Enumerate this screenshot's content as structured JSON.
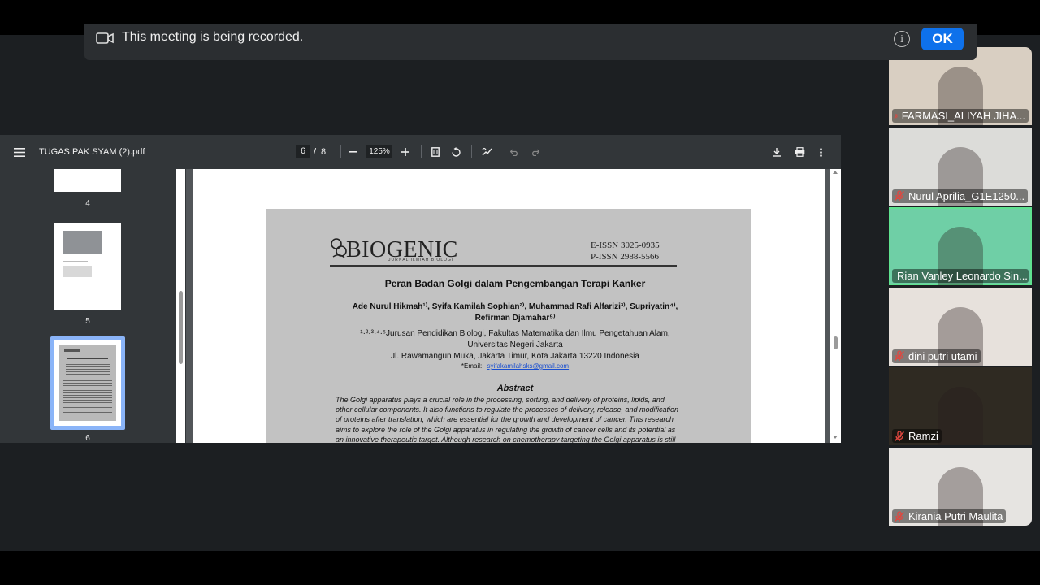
{
  "banner": {
    "message": "This meeting is being recorded.",
    "ok_label": "OK",
    "info_label": "i"
  },
  "pdf": {
    "file_name": "TUGAS PAK SYAM (2).pdf",
    "current_page": "6",
    "page_separator": "/",
    "total_pages": "8",
    "zoom": "125%",
    "thumbnails": [
      {
        "label": "4"
      },
      {
        "label": "5"
      },
      {
        "label": "6"
      }
    ]
  },
  "paper": {
    "journal_name": "BIOGENIC",
    "journal_subtitle": "JURNAL ILMIAH BIOLOGI",
    "e_issn": "E-ISSN 3025-0935",
    "p_issn": "P-ISSN 2988-5566",
    "title": "Peran Badan Golgi dalam Pengembangan Terapi Kanker",
    "authors_line1": "Ade Nurul Hikmah¹⁾, Syifa Kamilah Sophian²⁾, Muhammad Rafi Alfarizi³⁾, Supriyatin⁴⁾,",
    "authors_line2": "Refirman Djamahar⁵⁾",
    "affiliation_line1": "¹·²·³·⁴·⁵Jurusan Pendidikan Biologi, Fakultas Matematika dan Ilmu Pengetahuan Alam,",
    "affiliation_line2": "Universitas Negeri Jakarta",
    "affiliation_line3": "Jl. Rawamangun Muka, Jakarta Timur, Kota Jakarta 13220 Indonesia",
    "email_label": "*Email:",
    "email": "syifakamilahsks@gmail.com",
    "abstract_heading": "Abstract",
    "abstract_lines": [
      "The Golgi apparatus plays a crucial role in the processing, sorting, and delivery of proteins, lipids, and",
      "other cellular components. It also functions to regulate the processes of delivery, release, and modification",
      "of proteins after translation, which are essential for the growth and development of cancer. This research",
      "aims to explore the role of the Golgi apparatus in regulating the growth of cancer cells and its potential as",
      "an innovative therapeutic target. Although research on chemotherapy targeting the Golgi apparatus is still"
    ]
  },
  "participants": [
    {
      "name": "FARMASI_ALIYAH JIHA...",
      "bg": "#d9cfc2",
      "active": false
    },
    {
      "name": "Nurul Aprilia_G1E1250...",
      "bg": "#dcdcd9",
      "active": false
    },
    {
      "name": "Rian Vanley Leonardo Sin...",
      "bg": "#6fcfa6",
      "active": true
    },
    {
      "name": "dini putri utami",
      "bg": "#e7e1dc",
      "active": false
    },
    {
      "name": "Ramzi",
      "bg": "#2f2a22",
      "active": false
    },
    {
      "name": "Kirania Putri Maulita",
      "bg": "#e6e4e1",
      "active": false
    }
  ],
  "colors": {
    "accent": "#0e71eb",
    "active_border": "#5fe38f",
    "muted_red": "#e0473f",
    "toolbar": "#323639"
  }
}
